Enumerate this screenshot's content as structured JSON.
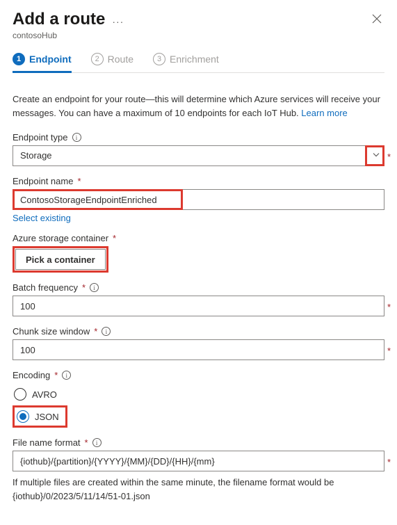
{
  "header": {
    "title": "Add a route",
    "subtitle": "contosoHub"
  },
  "tabs": {
    "items": [
      {
        "num": "1",
        "label": "Endpoint"
      },
      {
        "num": "2",
        "label": "Route"
      },
      {
        "num": "3",
        "label": "Enrichment"
      }
    ]
  },
  "intro": {
    "text": "Create an endpoint for your route—this will determine which Azure services will receive your messages. You can have a maximum of 10 endpoints for each IoT Hub. ",
    "link": "Learn more"
  },
  "endpointType": {
    "label": "Endpoint type",
    "value": "Storage"
  },
  "endpointName": {
    "label": "Endpoint name",
    "value": "ContosoStorageEndpointEnriched",
    "selectExisting": "Select existing"
  },
  "storageContainer": {
    "label": "Azure storage container",
    "button": "Pick a container"
  },
  "batchFrequency": {
    "label": "Batch frequency",
    "value": "100"
  },
  "chunkSize": {
    "label": "Chunk size window",
    "value": "100"
  },
  "encoding": {
    "label": "Encoding",
    "options": [
      {
        "label": "AVRO",
        "selected": false
      },
      {
        "label": "JSON",
        "selected": true
      }
    ]
  },
  "fileNameFormat": {
    "label": "File name format",
    "value": "{iothub}/{partition}/{YYYY}/{MM}/{DD}/{HH}/{mm}",
    "hint": "If multiple files are created within the same minute, the filename format would be {iothub}/0/2023/5/11/14/51-01.json"
  }
}
